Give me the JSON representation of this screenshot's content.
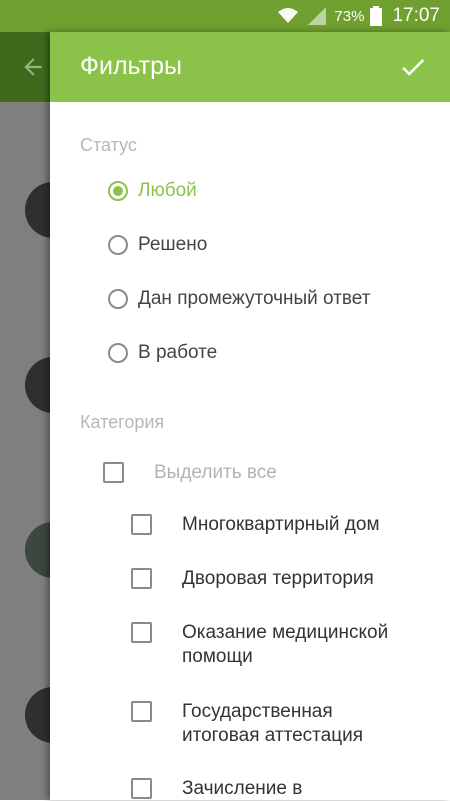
{
  "status_bar": {
    "battery": "73%",
    "time": "17:07"
  },
  "drawer": {
    "title": "Фильтры",
    "status_section": {
      "title": "Статус",
      "options": [
        {
          "label": "Любой",
          "selected": true
        },
        {
          "label": "Решено",
          "selected": false
        },
        {
          "label": "Дан промежуточный ответ",
          "selected": false
        },
        {
          "label": "В работе",
          "selected": false
        }
      ]
    },
    "category_section": {
      "title": "Категория",
      "select_all": "Выделить все",
      "items": [
        {
          "line1": "Многоквартирный дом",
          "line2": ""
        },
        {
          "line1": "Дворовая территория",
          "line2": ""
        },
        {
          "line1": "Оказание медицинской",
          "line2": "помощи"
        },
        {
          "line1": "Государственная",
          "line2": "итоговая аттестация"
        },
        {
          "line1": "Зачисление в",
          "line2": ""
        }
      ]
    }
  },
  "colors": {
    "accent": "#8bc34a",
    "status_bar": "#6e9f2f",
    "dim_overlay": "#7f7f7f"
  }
}
